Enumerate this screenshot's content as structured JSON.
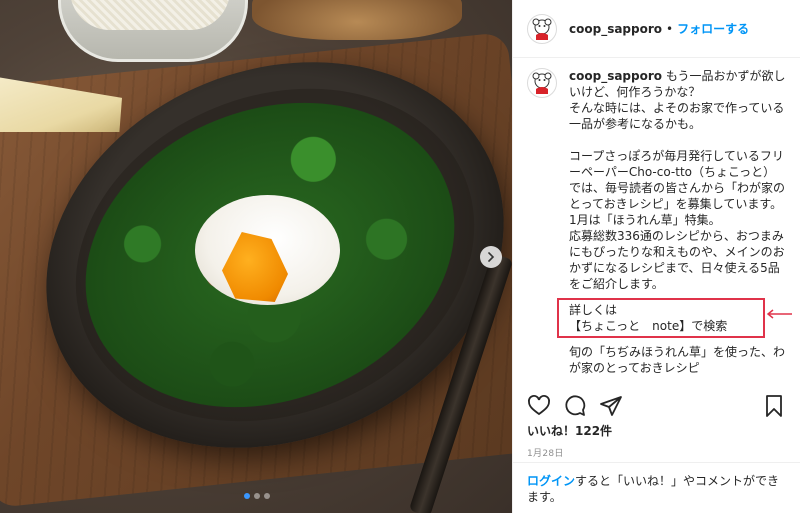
{
  "header": {
    "username": "coop_sapporo",
    "separator": "•",
    "follow_label": "フォローする"
  },
  "caption": {
    "username": "coop_sapporo",
    "lines_intro": "もう一品おかずが欲しいけど、何作ろうかな？\nそんな時には、よそのお家で作っている一品が参考になるかも。",
    "lines_body": "コープさっぽろが毎月発行しているフリーペーパーCho-co-tto（ちょこっと）では、毎号読者の皆さんから「わが家のとっておきレシピ」を募集しています。\n1月は「ほうれん草」特集。\n応募総数336通のレシピから、おつまみにもぴったりな和えものや、メインのおかずになるレシピまで、日々使える5品をご紹介します。",
    "highlight_line1": "詳しくは",
    "highlight_line2": "【ちょこっと　note】で検索",
    "lines_tail": "旬の「ちぢみほうれん草」を使った、わが家のとっておきレシピ"
  },
  "actions": {
    "like_icon": "heart-icon",
    "comment_icon": "comment-icon",
    "share_icon": "share-icon",
    "save_icon": "bookmark-icon"
  },
  "likes": "いいね！122件",
  "date": "1月28日",
  "footer": {
    "login_label": "ログイン",
    "rest_text": "すると「いいね！」やコメントができます。"
  },
  "carousel": {
    "active_index": 1,
    "count": 3
  },
  "colors": {
    "accent": "#0095f6",
    "highlight_border": "#e0334a",
    "active_dot": "#3a97ff"
  }
}
